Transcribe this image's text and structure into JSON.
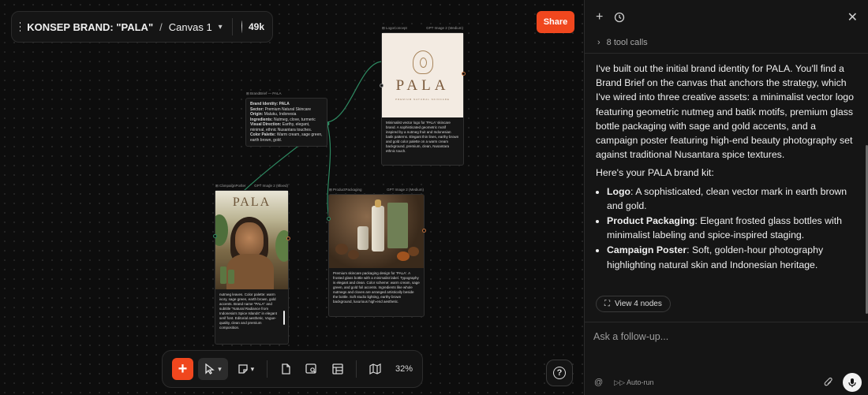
{
  "header": {
    "project_title": "KONSEP BRAND: \"PALA\"",
    "separator": "/",
    "canvas_name": "Canvas 1",
    "credits": "49k",
    "share_label": "Share"
  },
  "nodes": {
    "brief": {
      "head_left": "⊞ BrandBrief — PALA",
      "lines": [
        {
          "b": "Brand Identity: PALA",
          "t": ""
        },
        {
          "b": "Sector:",
          "t": " Premium Natural Skincare"
        },
        {
          "b": "Origin:",
          "t": " Maluku, Indonesia"
        },
        {
          "b": "Ingredients:",
          "t": " Nutmeg, clove, turmeric"
        },
        {
          "b": "Visual Direction:",
          "t": " Earthy, elegant, minimal, ethnic Nusantara touches."
        },
        {
          "b": "Color Palette:",
          "t": " Warm cream, sage green, earth brown, gold."
        }
      ]
    },
    "logo": {
      "head_left": "⊞ LogoConcept",
      "head_right": "GPT Image 2 (Medium)",
      "wordmark": "PALA",
      "tagline": "PREMIUM NATURAL SKINCARE",
      "text": "Minimalist vector logo for 'PALA' skincare brand. A sophisticated geometric motif inspired by a nutmeg fruit and Indonesian batik patterns. Elegant thin lines, earthy brown and gold color palette on a warm cream background, premium, clean, Nusantara ethnic touch."
    },
    "poster": {
      "head_left": "⊞ CampaignPoster",
      "head_right": "GPT Image 2 (Mixed)",
      "wordmark": "PALA",
      "text": "nutmeg leaves. Color palette: warm ivory, sage green, earth brown, gold accents. Brand name \"PALA\" and subtitle \"Natural Radiance from Indonesia's Spice Islands\" in elegant serif font. Editorial aesthetic, Vogue-quality, clean and premium composition."
    },
    "packaging": {
      "head_left": "⊞ ProductPackaging",
      "head_right": "GPT Image 2 (Medium)",
      "text": "Premium skincare packaging design for 'PALA'. A frosted glass bottle with a minimalist label. Typography is elegant and clean. Color scheme: warm cream, sage green, and gold foil accents. Ingredients like whole nutmegs and cloves are arranged artistically beside the bottle. Soft studio lighting, earthy brown background, luxurious high-end aesthetic."
    }
  },
  "toolbar": {
    "add_label": "+",
    "zoom": "32%"
  },
  "panel": {
    "tool_calls": "8 tool calls",
    "intro": "I've built out the initial brand identity for PALA. You'll find a Brand Brief on the canvas that anchors the strategy, which I've wired into three creative assets: a minimalist vector logo featuring geometric nutmeg and batik motifs, premium glass bottle packaging with sage and gold accents, and a campaign poster featuring high-end beauty photography set against traditional Nusantara spice textures.",
    "kit_heading": "Here's your PALA brand kit:",
    "kit": [
      {
        "label": "Logo",
        "desc": ": A sophisticated, clean vector mark in earth brown and gold."
      },
      {
        "label": "Product Packaging",
        "desc": ": Elegant frosted glass bottles with minimalist labeling and spice-inspired staging."
      },
      {
        "label": "Campaign Poster",
        "desc": ": Soft, golden-hour photography highlighting natural skin and Indonesian heritage."
      }
    ],
    "view_nodes": "View 4 nodes",
    "input_placeholder": "Ask a follow-up...",
    "auto_run": "Auto-run",
    "at_symbol": "@"
  },
  "colors": {
    "accent": "#f0471e",
    "panel_bg": "#151515",
    "canvas_bg": "#0d0d0d",
    "connector": "#2e8a62"
  },
  "icons": [
    "menu-icon",
    "chevron-down-icon",
    "avatar",
    "plus-icon",
    "history-icon",
    "close-icon",
    "chevron-right-icon",
    "nodes-icon",
    "at-icon",
    "auto-run-icon",
    "paperclip-icon",
    "mic-icon",
    "cursor-icon",
    "sticky-note-icon",
    "document-icon",
    "image-search-icon",
    "layout-icon",
    "map-icon",
    "help-icon"
  ]
}
